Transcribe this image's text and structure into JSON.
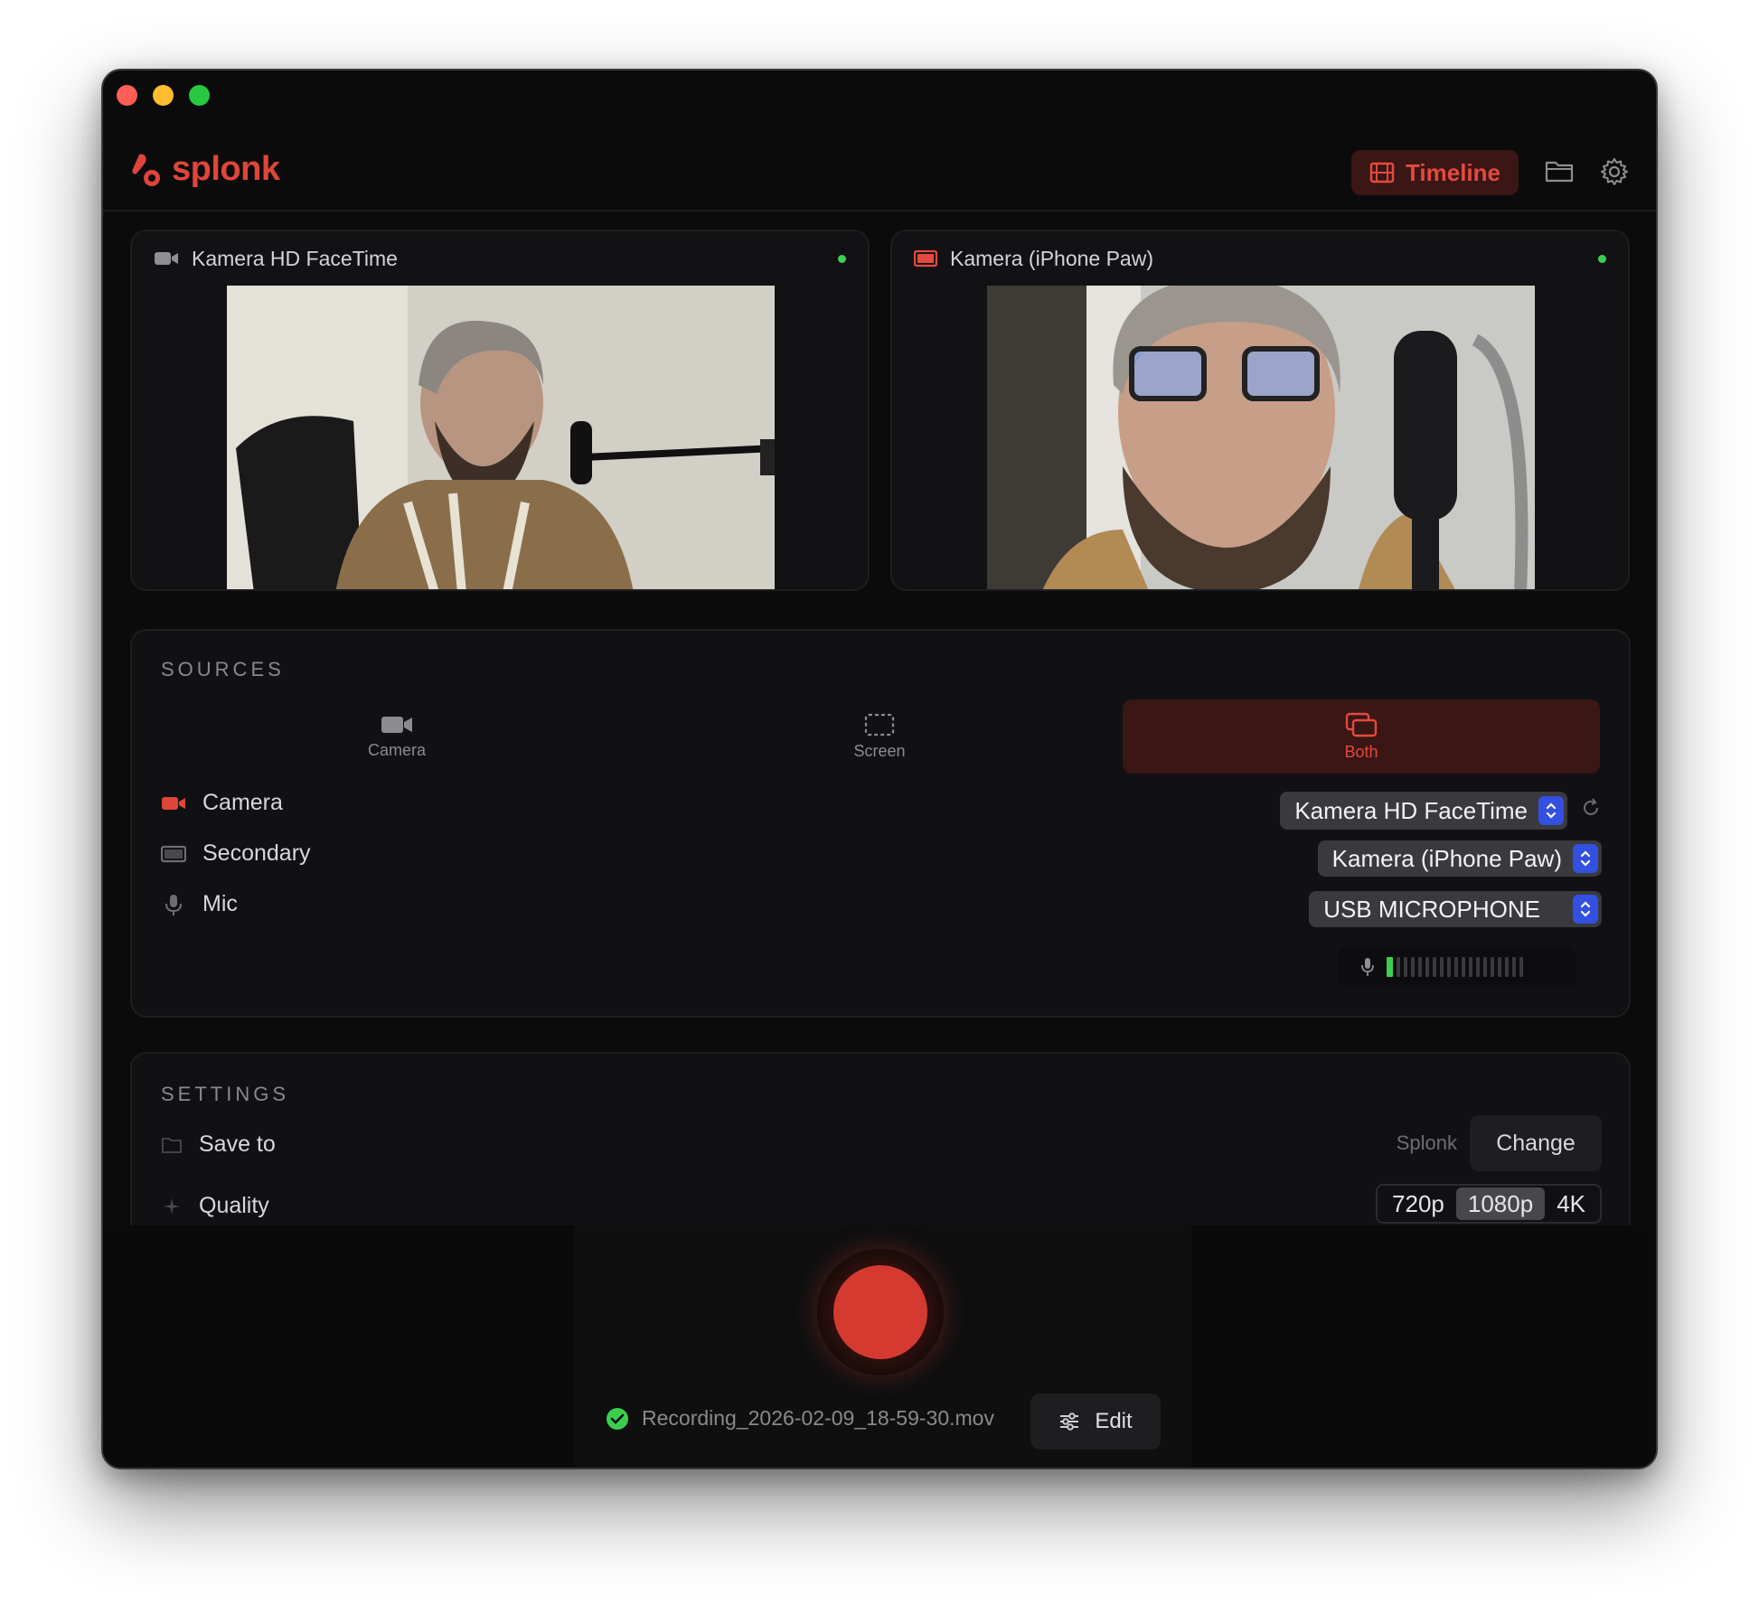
{
  "app": {
    "name": "splonk"
  },
  "header": {
    "timeline_label": "Timeline"
  },
  "previews": [
    {
      "title": "Kamera HD FaceTime"
    },
    {
      "title": "Kamera (iPhone Paw)"
    }
  ],
  "sources": {
    "title": "SOURCES",
    "modes": [
      {
        "label": "Camera",
        "icon": "video-camera-icon"
      },
      {
        "label": "Screen",
        "icon": "screen-select-icon"
      },
      {
        "label": "Both",
        "icon": "both-windows-icon",
        "selected": true
      }
    ],
    "rows": [
      {
        "label": "Camera",
        "value": "Kamera HD FaceTime"
      },
      {
        "label": "Secondary",
        "value": "Kamera (iPhone Paw)"
      },
      {
        "label": "Mic",
        "value": "USB MICROPHONE"
      }
    ],
    "mic_level": 0.05
  },
  "settings": {
    "title": "SETTINGS",
    "save_to": {
      "label": "Save to",
      "value": "Splonk",
      "button": "Change"
    },
    "quality": {
      "label": "Quality",
      "options": [
        "720p",
        "1080p",
        "4K"
      ],
      "selected": "1080p"
    }
  },
  "footer": {
    "filename": "Recording_2026-02-09_18-59-30.mov",
    "edit_label": "Edit"
  },
  "colors": {
    "accent": "#e44a3e",
    "record": "#d43a30",
    "ok": "#3ccf4e",
    "stepper": "#3350e0"
  }
}
